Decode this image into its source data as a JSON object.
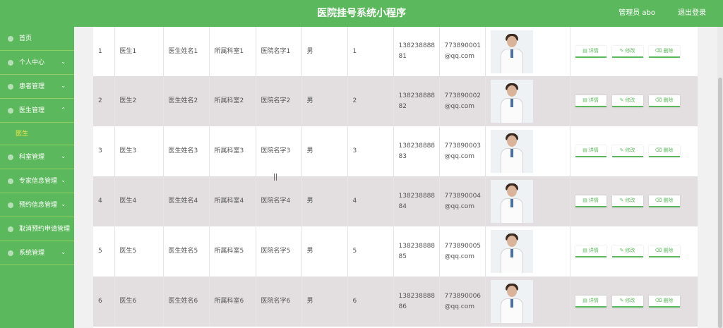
{
  "header": {
    "title": "医院挂号系统小程序",
    "user": "管理员 abo",
    "logout": "退出登录"
  },
  "sidebar": {
    "items": [
      {
        "label": "首页",
        "chev": ""
      },
      {
        "label": "个人中心",
        "chev": "⌄"
      },
      {
        "label": "患者管理",
        "chev": "⌄"
      },
      {
        "label": "医生管理",
        "chev": "⌃"
      },
      {
        "label": "科室管理",
        "chev": "⌄"
      },
      {
        "label": "专家信息管理",
        "chev": "⌄"
      },
      {
        "label": "预约信息管理",
        "chev": "⌄"
      },
      {
        "label": "取消预约申请管理",
        "chev": ""
      },
      {
        "label": "系统管理",
        "chev": "⌄"
      }
    ],
    "sub_active": "医生"
  },
  "actions": {
    "detail": "详情",
    "edit": "修改",
    "delete": "删除"
  },
  "rows": [
    {
      "no": "1",
      "account": "医生1",
      "name": "医生姓名1",
      "dept": "所属科室1",
      "hospital": "医院名字1",
      "gender": "男",
      "count": "1",
      "phone": "13823888881",
      "email": "773890001@qq.com"
    },
    {
      "no": "2",
      "account": "医生2",
      "name": "医生姓名2",
      "dept": "所属科室2",
      "hospital": "医院名字2",
      "gender": "男",
      "count": "2",
      "phone": "13823888882",
      "email": "773890002@qq.com"
    },
    {
      "no": "3",
      "account": "医生3",
      "name": "医生姓名3",
      "dept": "所属科室3",
      "hospital": "医院名字3",
      "gender": "男",
      "count": "3",
      "phone": "13823888883",
      "email": "773890003@qq.com"
    },
    {
      "no": "4",
      "account": "医生4",
      "name": "医生姓名4",
      "dept": "所属科室4",
      "hospital": "医院名字4",
      "gender": "男",
      "count": "4",
      "phone": "13823888884",
      "email": "773890004@qq.com"
    },
    {
      "no": "5",
      "account": "医生5",
      "name": "医生姓名5",
      "dept": "所属科室5",
      "hospital": "医院名字5",
      "gender": "男",
      "count": "5",
      "phone": "13823888885",
      "email": "773890005@qq.com"
    },
    {
      "no": "6",
      "account": "医生6",
      "name": "医生姓名6",
      "dept": "所属科室6",
      "hospital": "医院名字6",
      "gender": "男",
      "count": "6",
      "phone": "13823888886",
      "email": "773890006@qq.com"
    }
  ]
}
